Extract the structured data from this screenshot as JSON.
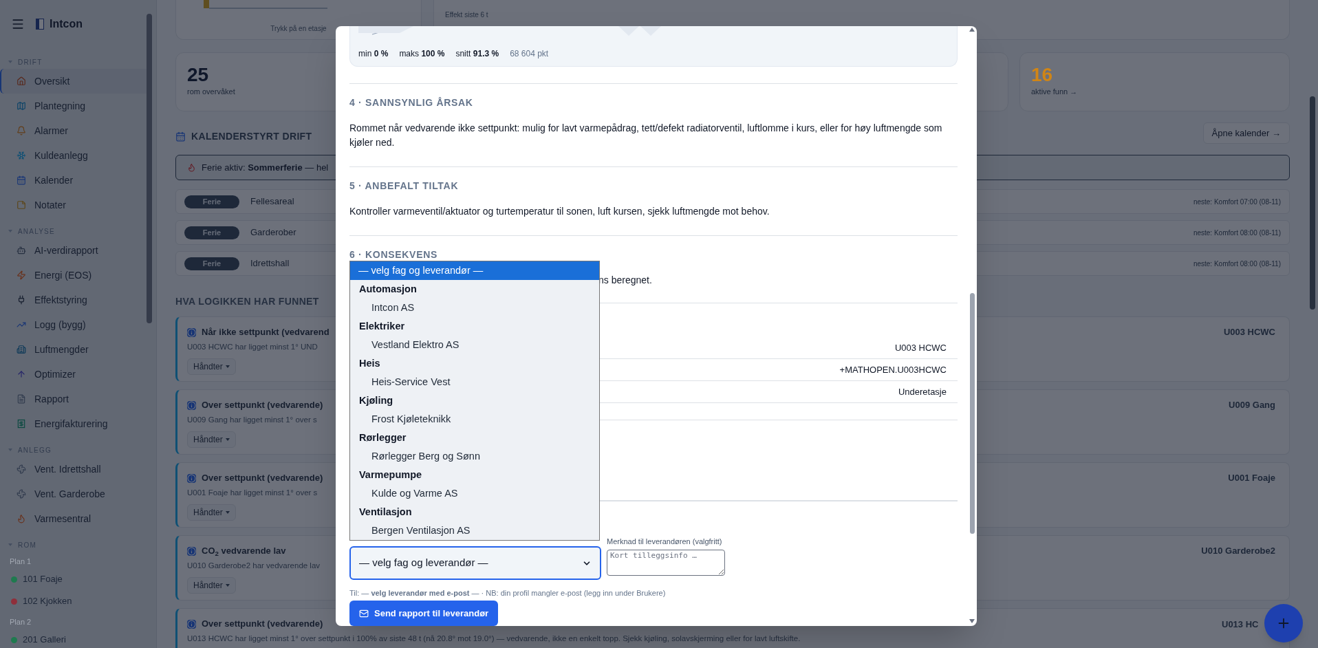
{
  "sidebar": {
    "brand": "Intcon",
    "sections": [
      {
        "kind": "nav",
        "title": "DRIFT",
        "items": [
          {
            "label": "Oversikt",
            "selected": true
          },
          {
            "label": "Plantegning",
            "selected": false
          },
          {
            "label": "Alarmer",
            "selected": false
          },
          {
            "label": "Kuldeanlegg",
            "selected": false
          },
          {
            "label": "Kalender",
            "selected": false
          },
          {
            "label": "Notater",
            "selected": false
          }
        ]
      },
      {
        "kind": "nav",
        "title": "ANALYSE",
        "items": [
          {
            "label": "AI-verdirapport",
            "selected": false
          },
          {
            "label": "Energi (EOS)",
            "selected": false
          },
          {
            "label": "Effektstyring",
            "selected": false
          },
          {
            "label": "Logg (bygg)",
            "selected": false
          },
          {
            "label": "Luftmengder",
            "selected": false
          },
          {
            "label": "Optimizer",
            "selected": false
          },
          {
            "label": "Rapport",
            "selected": false
          },
          {
            "label": "Energifakturering",
            "selected": false
          }
        ]
      },
      {
        "kind": "nav",
        "title": "ANLEGG",
        "items": [
          {
            "label": "Vent. Idrettshall",
            "selected": false
          },
          {
            "label": "Vent. Garderobe",
            "selected": false
          },
          {
            "label": "Varmesentral",
            "selected": false
          }
        ]
      },
      {
        "kind": "rooms",
        "title": "ROM",
        "groups": [
          {
            "label": "Plan 1",
            "rooms": [
              {
                "label": "101 Foaje",
                "color": "#1f7a4f"
              },
              {
                "label": "102 Kjokken",
                "color": "#8f2f3b"
              }
            ]
          },
          {
            "label": "Plan 2",
            "rooms": [
              {
                "label": "201 Galleri",
                "color": "#1f7a4f"
              }
            ]
          }
        ]
      }
    ]
  },
  "top_cards": [
    {
      "caption": "Trykk på en etasje"
    },
    {
      "caption": "Effekt siste 6 t"
    }
  ],
  "stats": [
    {
      "value": "25",
      "label": "rom overvåket",
      "color": "#0f172a"
    },
    {
      "value": "16",
      "label": "aktive funn →",
      "color": "#d08516"
    }
  ],
  "calendar": {
    "title": "KALENDERSTYRT DRIFT",
    "open_button": "Åpne kalender →",
    "banner": "Ferie aktiv: **Sommerferie** — hel",
    "rows": [
      {
        "badge": "Ferie",
        "name": "Fellesareal",
        "next": "neste: Komfort 07:00 (08-11)"
      },
      {
        "badge": "Ferie",
        "name": "Garderober",
        "next": "neste: Komfort 08:00 (08-11)"
      },
      {
        "badge": "Ferie",
        "name": "Idrettshall",
        "next": "neste: Komfort 08:00 (08-11)"
      }
    ]
  },
  "findings": {
    "title": "HVA LOGIKKEN HAR FUNNET",
    "items": [
      {
        "title": "Når ikke settpunkt (vedvarend",
        "text": "U003 HCWC har ligget minst 1° UND",
        "action": "Håndter",
        "room": "U003 HCWC"
      },
      {
        "title": "Over settpunkt (vedvarende)",
        "text": "U009 Gang har ligget minst 1° over s",
        "action": "Håndter",
        "room": "U009 Gang"
      },
      {
        "title": "Over settpunkt (vedvarende)",
        "text": "U001 Foaje har ligget minst 1° over s",
        "action": "Håndter",
        "room": "U001 Foaje"
      },
      {
        "title": "CO$_{2}$ vedvarende lav",
        "text": "U010 Garderobe2 har vedvarende lav",
        "action": "Håndter",
        "room": "U010 Garderobe2"
      },
      {
        "title": "Over settpunkt (vedvarende)",
        "text": "U013 HCWC har ligget minst 1° over settpunkt i 100% av siste 48 t (nå 20.8° mot 19.0°) — vedvarende, ikke en enkelt topp. Sjekk kjøling, solavskjerming eller for lavt luftskifte.",
        "room": "U013 HC"
      }
    ]
  },
  "modal": {
    "stats": [
      {
        "label": "min",
        "value": "0 %"
      },
      {
        "label": "maks",
        "value": "100 %"
      },
      {
        "label": "snitt",
        "value": "91.3 %"
      }
    ],
    "points": "68 604 pkt",
    "sections": [
      {
        "heading": "4 · SANNSYNLIG ÅRSAK",
        "text": "Rommet når vedvarende ikke settpunkt: mulig for lavt varmepådrag, tett/defekt radiatorventil, luftlomme i kurs, eller for høy luftmengde som kjøler ned."
      },
      {
        "heading": "5 · ANBEFALT TILTAK",
        "text": "Kontroller varmeventil/aktuator og turtemperatur til sonen, luft kursen, sjekk luftmengde mot behov."
      },
      {
        "heading": "6 · KONSEKVENS",
        "text": "ns beregnet."
      }
    ],
    "details": [
      "U003 HCWC",
      "+MATHOPEN.U003HCWC",
      "Underetasje"
    ],
    "note_label": "Merknad til leverandøren (valgfritt)",
    "note_placeholder": "Kort tilleggsinfo …",
    "select": {
      "value": "— velg fag og leverandør —",
      "expanded": true,
      "options": [
        {
          "kind": "option",
          "label": "— velg fag og leverandør —",
          "selected": true
        },
        {
          "kind": "group",
          "label": "Automasjon"
        },
        {
          "kind": "option",
          "label": "Intcon AS",
          "selected": false
        },
        {
          "kind": "group",
          "label": "Elektriker"
        },
        {
          "kind": "option",
          "label": "Vestland Elektro AS",
          "selected": false
        },
        {
          "kind": "group",
          "label": "Heis"
        },
        {
          "kind": "option",
          "label": "Heis-Service Vest",
          "selected": false
        },
        {
          "kind": "group",
          "label": "Kjøling"
        },
        {
          "kind": "option",
          "label": "Frost Kjøleteknikk",
          "selected": false
        },
        {
          "kind": "group",
          "label": "Rørlegger"
        },
        {
          "kind": "option",
          "label": "Rørlegger Berg og Sønn",
          "selected": false
        },
        {
          "kind": "group",
          "label": "Varmepumpe"
        },
        {
          "kind": "option",
          "label": "Kulde og Varme AS",
          "selected": false
        },
        {
          "kind": "group",
          "label": "Ventilasjon"
        },
        {
          "kind": "option",
          "label": "Bergen Ventilasjon AS",
          "selected": false
        }
      ]
    },
    "recipient": "Til: — **velg leverandør med e-post** — · NB: din profil mangler e-post (legg inn under Brukere)",
    "send_button": "Send rapport til leverandør"
  }
}
